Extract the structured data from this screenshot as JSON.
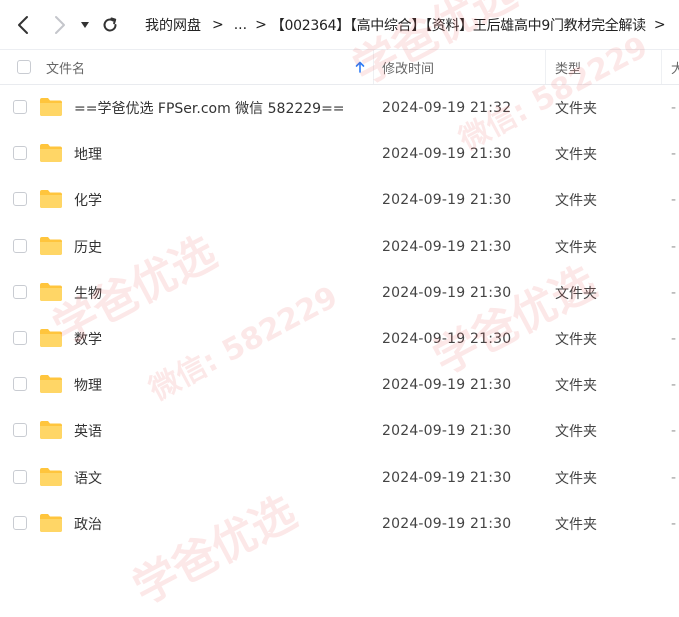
{
  "nav": {
    "back_icon": "chevron-left-icon",
    "forward_icon": "chevron-right-icon",
    "dropdown_icon": "caret-down-icon",
    "refresh_icon": "refresh-icon"
  },
  "breadcrumb": {
    "root": "我的网盘",
    "ellipsis": "...",
    "current": "【002364】【高中综合】【资料】王后雄高中9门教材完全解读",
    "separator": ">"
  },
  "columns": {
    "name": "文件名",
    "modified": "修改时间",
    "type": "类型",
    "size": "大"
  },
  "sort_icon": "arrow-up-icon",
  "accent_color": "#2f7cf6",
  "folder_color": "#ffc53d",
  "rows": [
    {
      "name": "==学爸优选 FPSer.com 微信 582229==",
      "modified": "2024-09-19 21:32",
      "type": "文件夹",
      "size": "-"
    },
    {
      "name": "地理",
      "modified": "2024-09-19 21:30",
      "type": "文件夹",
      "size": "-"
    },
    {
      "name": "化学",
      "modified": "2024-09-19 21:30",
      "type": "文件夹",
      "size": "-"
    },
    {
      "name": "历史",
      "modified": "2024-09-19 21:30",
      "type": "文件夹",
      "size": "-"
    },
    {
      "name": "生物",
      "modified": "2024-09-19 21:30",
      "type": "文件夹",
      "size": "-"
    },
    {
      "name": "数学",
      "modified": "2024-09-19 21:30",
      "type": "文件夹",
      "size": "-"
    },
    {
      "name": "物理",
      "modified": "2024-09-19 21:30",
      "type": "文件夹",
      "size": "-"
    },
    {
      "name": "英语",
      "modified": "2024-09-19 21:30",
      "type": "文件夹",
      "size": "-"
    },
    {
      "name": "语文",
      "modified": "2024-09-19 21:30",
      "type": "文件夹",
      "size": "-"
    },
    {
      "name": "政治",
      "modified": "2024-09-19 21:30",
      "type": "文件夹",
      "size": "-"
    }
  ],
  "watermark": {
    "brand": "学爸优选",
    "wechat": "微信: 582229"
  }
}
